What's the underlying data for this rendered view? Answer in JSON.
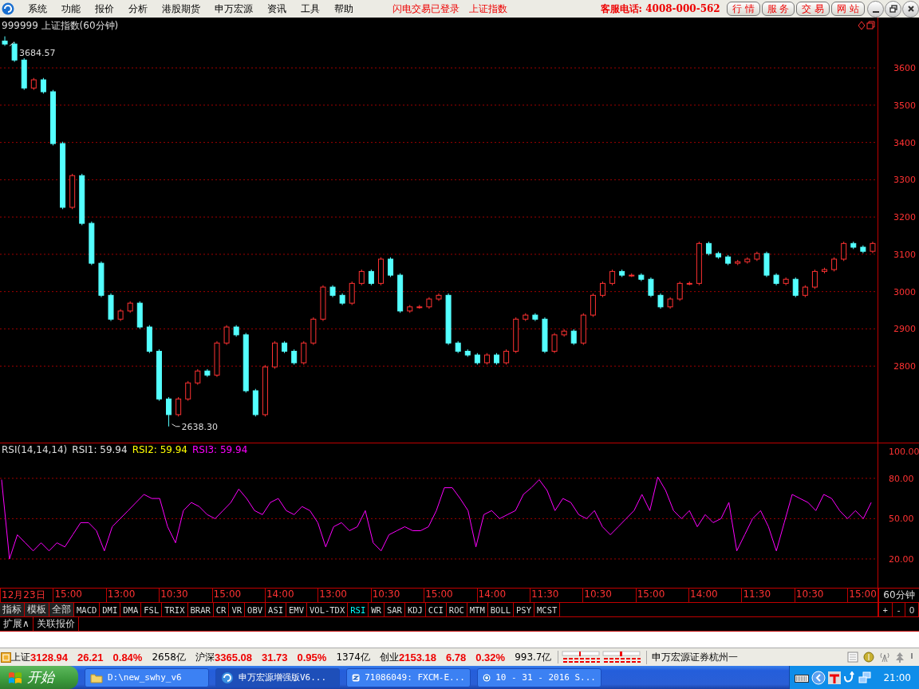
{
  "menu": {
    "items": [
      "系统",
      "功能",
      "报价",
      "分析",
      "港股期货",
      "申万宏源",
      "资讯",
      "工具",
      "帮助"
    ],
    "notices": [
      "闪电交易已登录",
      "上证指数"
    ],
    "hotline": "客服电话: 4008-000-562",
    "buttons": [
      "行 情",
      "服 务",
      "交 易",
      "网 站"
    ]
  },
  "price_panel": {
    "title": "999999 上证指数(60分钟)",
    "high_label": "3684.57",
    "low_label": "2638.30",
    "chart_data": {
      "type": "candlestick",
      "grid": true,
      "ylim": [
        2595,
        3735
      ],
      "yticks": [
        2800,
        2900,
        3000,
        3100,
        3200,
        3300,
        3400,
        3500,
        3600
      ],
      "ohlc": [
        [
          3672,
          3684.57,
          3659,
          3664
        ],
        [
          3664,
          3669,
          3616,
          3621
        ],
        [
          3621,
          3626,
          3541,
          3546
        ],
        [
          3546,
          3573,
          3541,
          3568
        ],
        [
          3568,
          3573,
          3531,
          3536
        ],
        [
          3536,
          3541,
          3392,
          3397
        ],
        [
          3397,
          3402,
          3221,
          3226
        ],
        [
          3226,
          3316,
          3221,
          3311
        ],
        [
          3311,
          3316,
          3178,
          3183
        ],
        [
          3183,
          3188,
          3071,
          3076
        ],
        [
          3076,
          3081,
          2985,
          2990
        ],
        [
          2990,
          2995,
          2921,
          2926
        ],
        [
          2926,
          2953,
          2921,
          2948
        ],
        [
          2948,
          2974,
          2943,
          2969
        ],
        [
          2969,
          2974,
          2900,
          2905
        ],
        [
          2905,
          2910,
          2835,
          2840
        ],
        [
          2840,
          2845,
          2707,
          2712
        ],
        [
          2712,
          2717,
          2638.3,
          2670
        ],
        [
          2670,
          2717,
          2665,
          2712
        ],
        [
          2712,
          2760,
          2707,
          2755
        ],
        [
          2755,
          2792,
          2750,
          2787
        ],
        [
          2787,
          2792,
          2771,
          2776
        ],
        [
          2776,
          2867,
          2771,
          2862
        ],
        [
          2862,
          2910,
          2857,
          2905
        ],
        [
          2905,
          2910,
          2879,
          2884
        ],
        [
          2884,
          2889,
          2729,
          2734
        ],
        [
          2734,
          2739,
          2665,
          2670
        ],
        [
          2670,
          2803,
          2665,
          2798
        ],
        [
          2798,
          2867,
          2793,
          2862
        ],
        [
          2862,
          2867,
          2835,
          2840
        ],
        [
          2840,
          2845,
          2804,
          2809
        ],
        [
          2809,
          2867,
          2804,
          2862
        ],
        [
          2862,
          2931,
          2857,
          2926
        ],
        [
          2926,
          3017,
          2921,
          3012
        ],
        [
          3012,
          3017,
          2985,
          2990
        ],
        [
          2990,
          2995,
          2964,
          2969
        ],
        [
          2969,
          3027,
          2964,
          3022
        ],
        [
          3022,
          3059,
          3017,
          3054
        ],
        [
          3054,
          3059,
          3017,
          3022
        ],
        [
          3022,
          3092,
          3017,
          3087
        ],
        [
          3087,
          3092,
          3039,
          3044
        ],
        [
          3044,
          3049,
          2943,
          2948
        ],
        [
          2948,
          2964,
          2943,
          2959
        ],
        [
          2959,
          2964,
          2954,
          2959
        ],
        [
          2959,
          2985,
          2954,
          2980
        ],
        [
          2980,
          2995,
          2975,
          2990
        ],
        [
          2990,
          2995,
          2857,
          2862
        ],
        [
          2862,
          2867,
          2835,
          2840
        ],
        [
          2840,
          2845,
          2825,
          2830
        ],
        [
          2830,
          2835,
          2804,
          2809
        ],
        [
          2809,
          2835,
          2804,
          2830
        ],
        [
          2830,
          2835,
          2804,
          2809
        ],
        [
          2809,
          2845,
          2804,
          2840
        ],
        [
          2840,
          2931,
          2835,
          2926
        ],
        [
          2926,
          2942,
          2921,
          2937
        ],
        [
          2937,
          2942,
          2921,
          2926
        ],
        [
          2926,
          2931,
          2835,
          2840
        ],
        [
          2840,
          2889,
          2835,
          2884
        ],
        [
          2884,
          2899,
          2879,
          2894
        ],
        [
          2894,
          2899,
          2857,
          2862
        ],
        [
          2862,
          2942,
          2857,
          2937
        ],
        [
          2937,
          2995,
          2932,
          2990
        ],
        [
          2990,
          3027,
          2985,
          3022
        ],
        [
          3022,
          3059,
          3017,
          3054
        ],
        [
          3054,
          3059,
          3039,
          3044
        ],
        [
          3044,
          3049,
          3039,
          3044
        ],
        [
          3044,
          3049,
          3028,
          3033
        ],
        [
          3033,
          3038,
          2985,
          2990
        ],
        [
          2990,
          2995,
          2954,
          2959
        ],
        [
          2959,
          2985,
          2954,
          2980
        ],
        [
          2980,
          3027,
          2975,
          3022
        ],
        [
          3022,
          3027,
          3017,
          3022
        ],
        [
          3022,
          3134,
          3017,
          3129
        ],
        [
          3129,
          3134,
          3097,
          3102
        ],
        [
          3102,
          3107,
          3088,
          3093
        ],
        [
          3093,
          3098,
          3071,
          3076
        ],
        [
          3076,
          3085,
          3071,
          3080
        ],
        [
          3080,
          3092,
          3075,
          3087
        ],
        [
          3087,
          3107,
          3082,
          3102
        ],
        [
          3102,
          3107,
          3039,
          3044
        ],
        [
          3044,
          3049,
          3017,
          3022
        ],
        [
          3022,
          3038,
          3017,
          3033
        ],
        [
          3033,
          3038,
          2985,
          2990
        ],
        [
          2990,
          3017,
          2985,
          3012
        ],
        [
          3012,
          3059,
          3007,
          3054
        ],
        [
          3054,
          3064,
          3049,
          3059
        ],
        [
          3059,
          3092,
          3054,
          3087
        ],
        [
          3087,
          3134,
          3082,
          3129
        ],
        [
          3129,
          3134,
          3114,
          3119
        ],
        [
          3119,
          3124,
          3103,
          3108
        ],
        [
          3108,
          3134,
          3103,
          3129
        ]
      ]
    }
  },
  "rsi_panel": {
    "name": "RSI(14,14,14)",
    "readings": [
      {
        "label": "RSI1: 59.94",
        "color": "#e0e0e0"
      },
      {
        "label": "RSI2: 59.94",
        "color": "#ffff00"
      },
      {
        "label": "RSI3: 59.94",
        "color": "#ff00ff"
      }
    ],
    "chart_data": {
      "type": "line",
      "grid": true,
      "ylim": [
        -2,
        106
      ],
      "yticks": [
        {
          "value": 20,
          "label": "20.00"
        },
        {
          "value": 50,
          "label": "50.00"
        },
        {
          "value": 80,
          "label": "80.00"
        },
        {
          "value": 100,
          "label": "100.00"
        }
      ],
      "series": [
        {
          "color": "#ff00ff",
          "values": [
            79,
            20,
            38,
            32,
            26,
            32,
            26,
            32,
            29,
            38,
            47,
            47,
            41,
            26,
            44,
            50,
            56,
            62,
            68,
            65,
            65,
            44,
            32,
            56,
            62,
            59,
            53,
            50,
            56,
            62,
            72,
            65,
            56,
            53,
            62,
            65,
            56,
            53,
            59,
            56,
            47,
            29,
            44,
            47,
            41,
            44,
            56,
            32,
            26,
            38,
            41,
            44,
            41,
            41,
            44,
            56,
            73,
            73,
            65,
            56,
            29,
            53,
            56,
            50,
            53,
            56,
            68,
            73,
            79,
            71,
            56,
            65,
            62,
            53,
            50,
            56,
            44,
            38,
            44,
            50,
            56,
            68,
            56,
            81,
            71,
            56,
            50,
            56,
            44,
            53,
            47,
            50,
            62,
            26,
            38,
            50,
            56,
            44,
            26,
            47,
            68,
            65,
            62,
            56,
            68,
            65,
            56,
            50,
            56,
            50,
            62
          ]
        }
      ]
    }
  },
  "time_axis": {
    "labels": [
      "12月23日",
      "15:00",
      "13:00",
      "10:30",
      "15:00",
      "14:00",
      "13:00",
      "10:30",
      "15:00",
      "14:00",
      "11:30",
      "10:30",
      "15:00",
      "14:00",
      "11:30",
      "10:30",
      "15:00"
    ],
    "period": "60分钟"
  },
  "indicator_tabs": [
    {
      "label": "指标",
      "kind": "group",
      "selected": false
    },
    {
      "label": "模板",
      "kind": "group",
      "selected": false
    },
    {
      "label": "全部",
      "kind": "group",
      "selected": false
    },
    {
      "label": "MACD",
      "kind": "indicator",
      "selected": false
    },
    {
      "label": "DMI",
      "kind": "indicator",
      "selected": false
    },
    {
      "label": "DMA",
      "kind": "indicator",
      "selected": false
    },
    {
      "label": "FSL",
      "kind": "indicator",
      "selected": false
    },
    {
      "label": "TRIX",
      "kind": "indicator",
      "selected": false
    },
    {
      "label": "BRAR",
      "kind": "indicator",
      "selected": false
    },
    {
      "label": "CR",
      "kind": "indicator",
      "selected": false
    },
    {
      "label": "VR",
      "kind": "indicator",
      "selected": false
    },
    {
      "label": "OBV",
      "kind": "indicator",
      "selected": false
    },
    {
      "label": "ASI",
      "kind": "indicator",
      "selected": false
    },
    {
      "label": "EMV",
      "kind": "indicator",
      "selected": false
    },
    {
      "label": "VOL-TDX",
      "kind": "indicator",
      "selected": false
    },
    {
      "label": "RSI",
      "kind": "indicator",
      "selected": true
    },
    {
      "label": "WR",
      "kind": "indicator",
      "selected": false
    },
    {
      "label": "SAR",
      "kind": "indicator",
      "selected": false
    },
    {
      "label": "KDJ",
      "kind": "indicator",
      "selected": false
    },
    {
      "label": "CCI",
      "kind": "indicator",
      "selected": false
    },
    {
      "label": "ROC",
      "kind": "indicator",
      "selected": false
    },
    {
      "label": "MTM",
      "kind": "indicator",
      "selected": false
    },
    {
      "label": "BOLL",
      "kind": "indicator",
      "selected": false
    },
    {
      "label": "PSY",
      "kind": "indicator",
      "selected": false
    },
    {
      "label": "MCST",
      "kind": "indicator",
      "selected": false
    }
  ],
  "zoom_buttons": [
    "+",
    "-",
    "0"
  ],
  "lower_tabs": [
    "扩展∧",
    "关联报价"
  ],
  "status_bar": {
    "indices": [
      {
        "name": "上证",
        "price": "3128.94",
        "change": "26.21",
        "percent": "0.84%",
        "turnover": "2658亿"
      },
      {
        "name": "沪深",
        "price": "3365.08",
        "change": "31.73",
        "percent": "0.95%",
        "turnover": "1374亿"
      },
      {
        "name": "创业",
        "price": "2153.18",
        "change": "6.78",
        "percent": "0.32%",
        "turnover": "993.7亿"
      }
    ],
    "server": "申万宏源证券杭州一"
  },
  "taskbar": {
    "start": "开始",
    "tasks": [
      {
        "label": "D:\\new_swhy_v6",
        "selected": false
      },
      {
        "label": "申万宏源增强版V6...",
        "selected": true
      },
      {
        "label": "71086049: FXCM-E...",
        "selected": false
      },
      {
        "label": "10 - 31 - 2016 S...",
        "selected": false
      }
    ],
    "clock": "21:00"
  }
}
